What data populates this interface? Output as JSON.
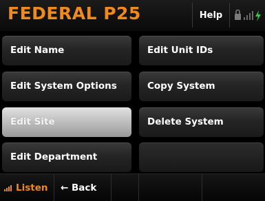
{
  "header": {
    "title": "FEDERAL P25",
    "help_label": "Help",
    "icons": [
      "lock-icon",
      "signal-bars-icon",
      "power-bolt-icon"
    ]
  },
  "menu": {
    "edit_name": "Edit Name",
    "edit_unit_ids": "Edit Unit IDs",
    "edit_system_options": "Edit System Options",
    "copy_system": "Copy System",
    "edit_site": "Edit Site",
    "delete_system": "Delete System",
    "edit_department": "Edit Department",
    "selected_item": "Edit Site"
  },
  "footer": {
    "listen_label": "Listen",
    "back_label": "← Back"
  },
  "colors": {
    "accent": "#f08a1c",
    "background": "#000000",
    "button": "#2a2a2a",
    "selected_button": "#bdbdbd"
  }
}
